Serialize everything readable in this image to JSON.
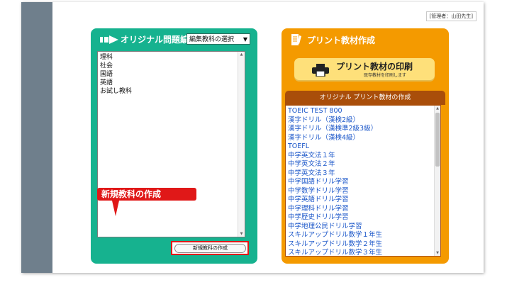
{
  "header": {
    "admin_label": "[管理者：山田先生]"
  },
  "editor_panel": {
    "title": "オリジナル問題編集",
    "subject_select": {
      "selected": "編集教科の選択"
    },
    "subjects": [
      "理科",
      "社会",
      "国語",
      "英語",
      "お試し教科"
    ],
    "callout_label": "新規教科の作成",
    "new_subject_button": "新規教科の作成"
  },
  "print_panel": {
    "title": "プリント教材作成",
    "print_button": {
      "label": "プリント教材の印刷",
      "sublabel": "既存教材を印刷します"
    },
    "original_section_title": "オリジナル プリント教材の作成",
    "materials": [
      "TOEIC TEST 800",
      "漢字ドリル（漢検2級）",
      "漢字ドリル（漢検準2級3級）",
      "漢字ドリル（漢検4級）",
      "TOEFL",
      "中学英文法１年",
      "中学英文法２年",
      "中学英文法３年",
      "中学国語ドリル学習",
      "中学数学ドリル学習",
      "中学英語ドリル学習",
      "中学理科ドリル学習",
      "中学歴史ドリル学習",
      "中学地理公民ドリル学習",
      "スキルアップドリル数学１年生",
      "スキルアップドリル数学２年生",
      "スキルアップドリル数学３年生"
    ]
  },
  "colors": {
    "sidebar": "#6f7f8c",
    "editor_panel": "#16b28f",
    "print_panel": "#f49a00",
    "callout": "#e01818",
    "link": "#1a56c9"
  }
}
